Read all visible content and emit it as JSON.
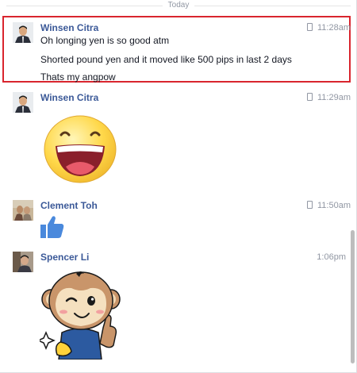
{
  "separator": {
    "label": "Today"
  },
  "messages": [
    {
      "sender": "Winsen Citra",
      "time": "11:28am",
      "lines": [
        "Oh longing yen is so good atm",
        "Shorted pound yen and it moved like 500 pips in last 2 days",
        "Thats my angpow"
      ]
    },
    {
      "sender": "Winsen Citra",
      "time": "11:29am"
    },
    {
      "sender": "Clement Toh",
      "time": "11:50am"
    },
    {
      "sender": "Spencer Li",
      "time": "1:06pm"
    }
  ],
  "colors": {
    "name": "#3b5998",
    "highlight": "#d9252e",
    "muted": "#9197a3",
    "like": "#4a89dc"
  }
}
